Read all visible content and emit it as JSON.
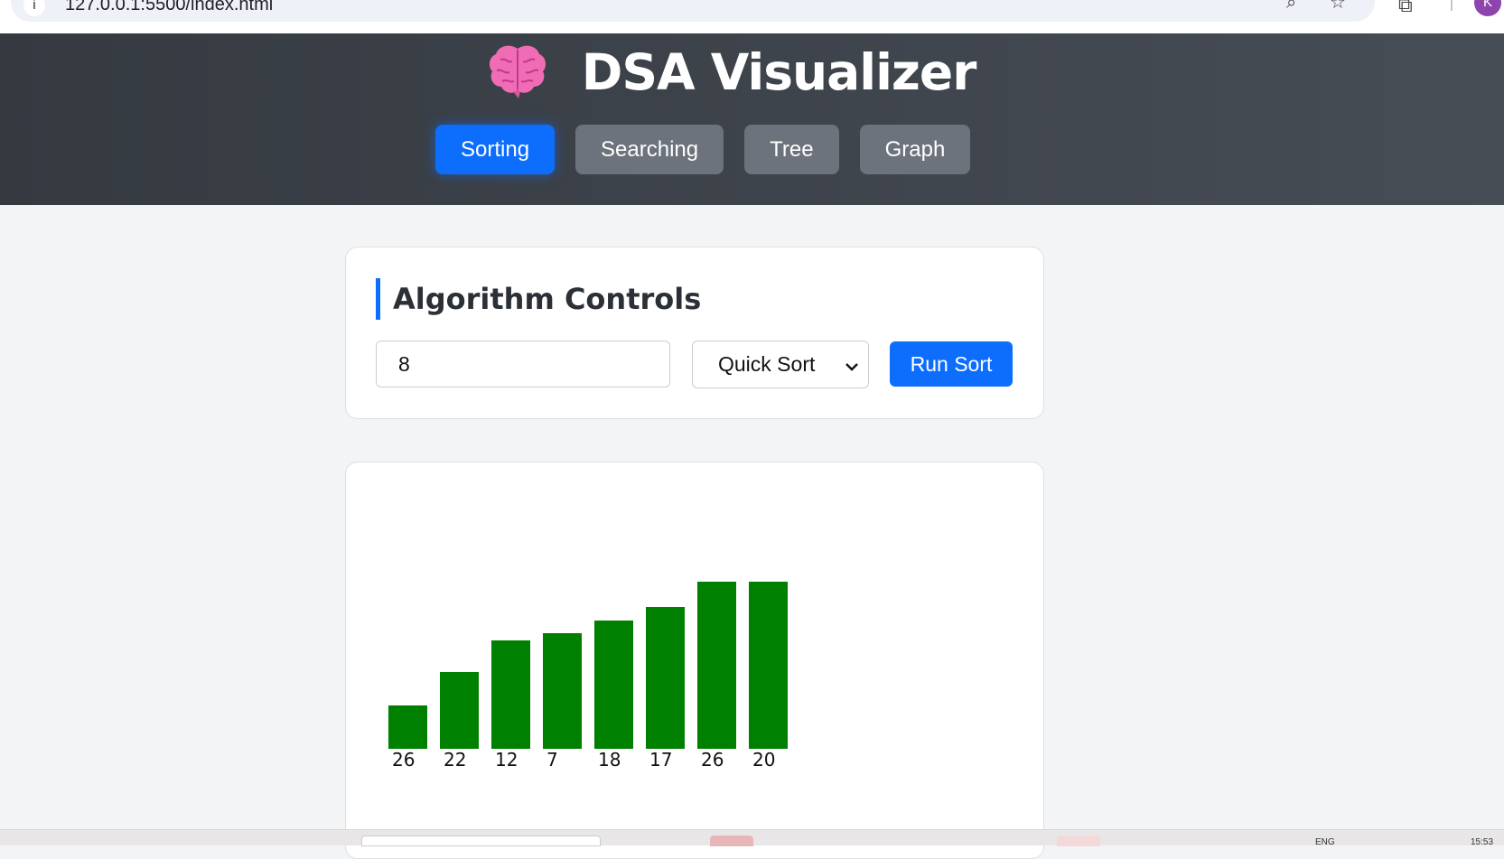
{
  "browser": {
    "url": "127.0.0.1:5500/index.html",
    "avatar_initial": "K"
  },
  "header": {
    "title": "DSA Visualizer",
    "brand_icon": "brain-icon",
    "tabs": [
      {
        "label": "Sorting",
        "active": true
      },
      {
        "label": "Searching",
        "active": false
      },
      {
        "label": "Tree",
        "active": false
      },
      {
        "label": "Graph",
        "active": false
      }
    ]
  },
  "controls": {
    "title": "Algorithm Controls",
    "array_input_value": "8",
    "algorithm_selected": "Quick Sort",
    "run_label": "Run Sort"
  },
  "visualizer": {
    "bar_color": "#008000",
    "bars": [
      {
        "label": "26",
        "level": 0.26
      },
      {
        "label": "22",
        "level": 0.46
      },
      {
        "label": "12",
        "level": 0.65
      },
      {
        "label": "7",
        "level": 0.69
      },
      {
        "label": "18",
        "level": 0.77
      },
      {
        "label": "17",
        "level": 0.85
      },
      {
        "label": "26",
        "level": 1.0
      },
      {
        "label": "20",
        "level": 1.0
      }
    ]
  },
  "taskbar": {
    "lang": "ENG",
    "time": "15:53"
  },
  "colors": {
    "accent": "#0d6efd",
    "header_bg": "#3d434a",
    "inactive_tab": "#6c737c"
  }
}
